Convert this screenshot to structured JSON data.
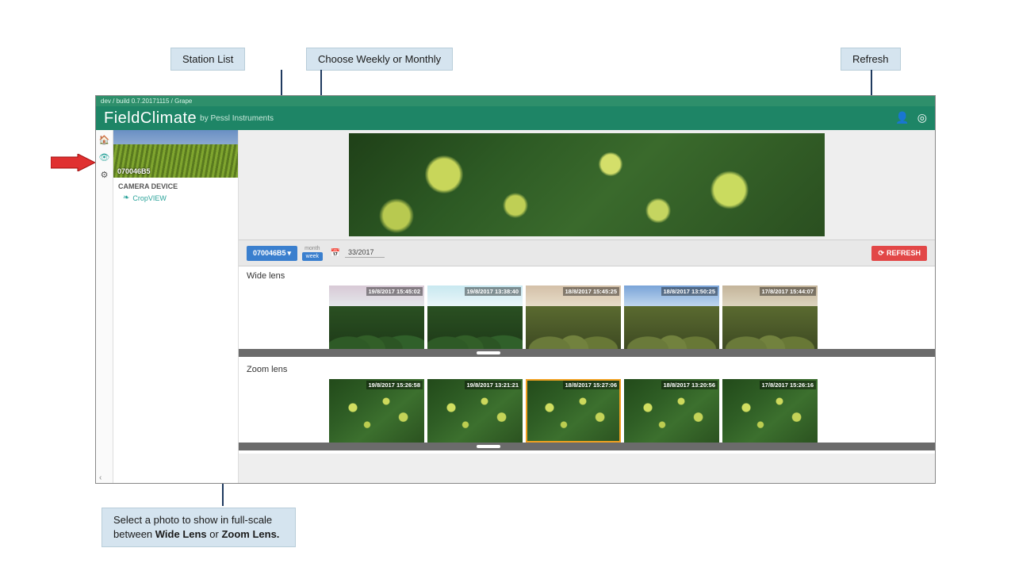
{
  "annotations": {
    "station_list": "Station List",
    "choose_period": "Choose Weekly or Monthly",
    "refresh": "Refresh",
    "select_photo_part1": "Select a photo to show in full-scale between ",
    "select_photo_bold1": "Wide Lens",
    "select_photo_mid": " or ",
    "select_photo_bold2": "Zoom Lens."
  },
  "breadcrumb": "dev / build 0.7.20171115 / Grape",
  "logo": {
    "main": "FieldClimate",
    "sub": "by Pessl Instruments"
  },
  "sidebar": {
    "station_id": "070046B5",
    "section_title": "CAMERA DEVICE",
    "item_label": "CropVIEW"
  },
  "toolbar": {
    "station_btn": "070046B5",
    "toggle_month": "month",
    "toggle_week": "week",
    "week_value": "33/2017",
    "refresh_label": "REFRESH"
  },
  "sections": {
    "wide": "Wide lens",
    "zoom": "Zoom lens"
  },
  "wide_thumbs": [
    {
      "ts": "19/8/2017 15:45:02",
      "sky": "linear-gradient(#d8c9d6,#e4e7ea)",
      "ground": "treeline"
    },
    {
      "ts": "19/8/2017 13:38:40",
      "sky": "linear-gradient(#c8e8f0,#eaf6f9)",
      "ground": "treeline"
    },
    {
      "ts": "18/8/2017 15:45:25",
      "sky": "linear-gradient(#d4c0a8,#e6dcc8)",
      "ground": "treeline-warm"
    },
    {
      "ts": "18/8/2017 13:50:25",
      "sky": "linear-gradient(#7aa4d8,#bfd6ee)",
      "ground": "treeline-warm"
    },
    {
      "ts": "17/8/2017 15:44:07",
      "sky": "linear-gradient(#c4b49a,#dcd4be)",
      "ground": "treeline-warm"
    }
  ],
  "zoom_thumbs": [
    {
      "ts": "19/8/2017 15:26:58",
      "sel": false
    },
    {
      "ts": "19/8/2017 13:21:21",
      "sel": false
    },
    {
      "ts": "18/8/2017 15:27:06",
      "sel": true
    },
    {
      "ts": "18/8/2017 13:20:56",
      "sel": false
    },
    {
      "ts": "17/8/2017 15:26:16",
      "sel": false
    }
  ]
}
